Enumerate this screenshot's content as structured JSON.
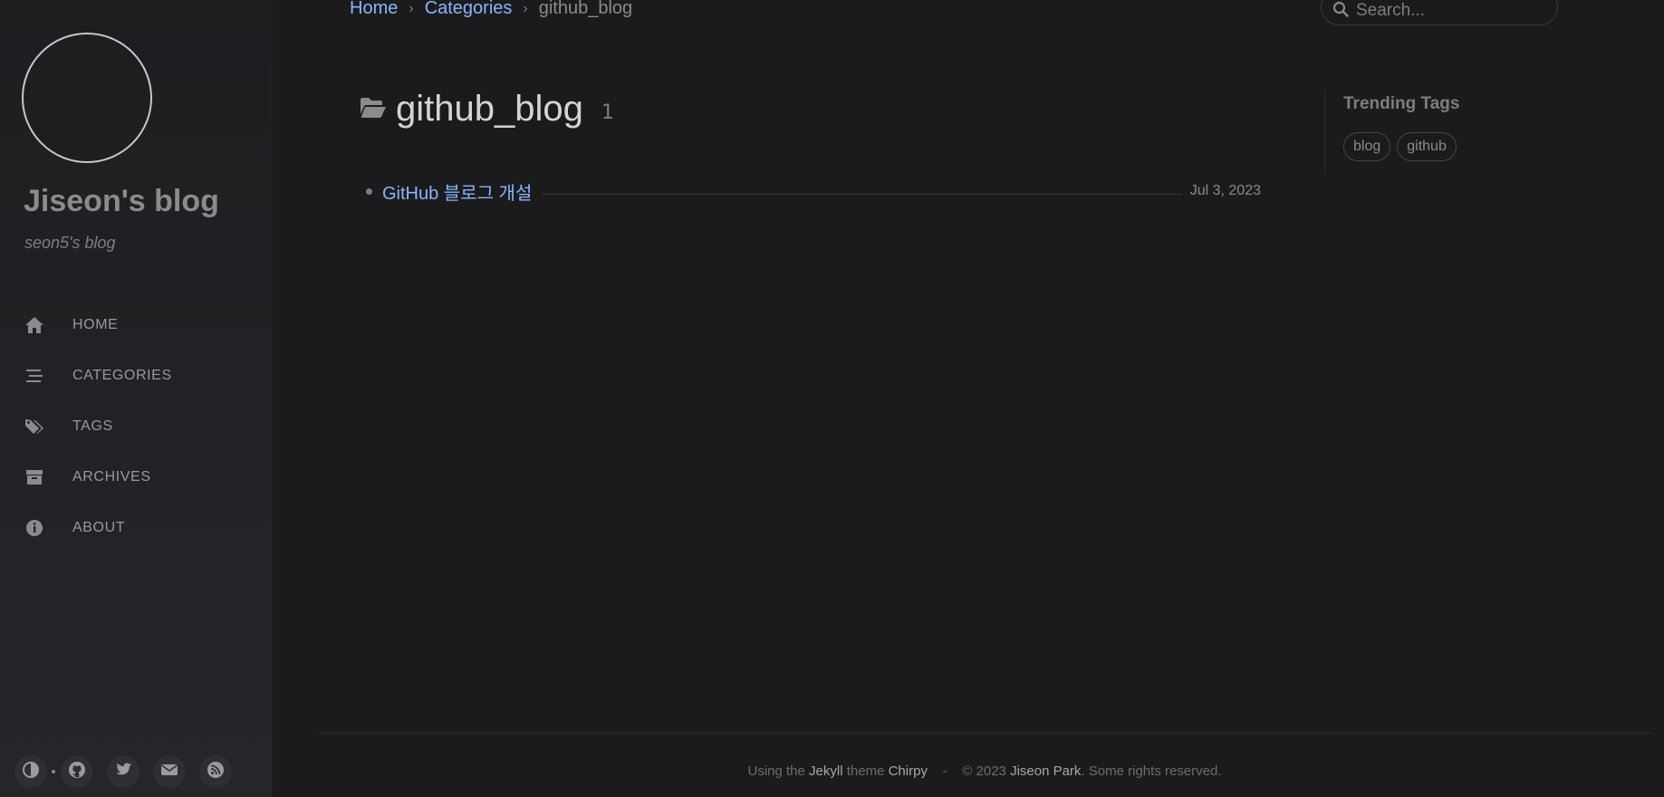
{
  "sidebar": {
    "site_title": "Jiseon's blog",
    "site_subtitle": "seon5's blog",
    "nav": [
      {
        "label": "HOME",
        "icon": "home-icon"
      },
      {
        "label": "CATEGORIES",
        "icon": "stream-icon"
      },
      {
        "label": "TAGS",
        "icon": "tags-icon"
      },
      {
        "label": "ARCHIVES",
        "icon": "archive-icon"
      },
      {
        "label": "ABOUT",
        "icon": "info-circle-icon"
      }
    ],
    "bottom_icons": [
      "theme-toggle-icon",
      "github-icon",
      "twitter-icon",
      "email-icon",
      "rss-icon"
    ]
  },
  "topbar": {
    "breadcrumb": {
      "home": "Home",
      "categories": "Categories",
      "current": "github_blog",
      "separator": "›"
    },
    "search_placeholder": "Search..."
  },
  "main": {
    "heading": {
      "title": "github_blog",
      "count": "1",
      "icon": "folder-open-icon"
    },
    "posts": [
      {
        "title": "GitHub 블로그 개설",
        "date": "Jul 3, 2023"
      }
    ]
  },
  "panel": {
    "title": "Trending Tags",
    "tags": [
      "blog",
      "github"
    ]
  },
  "footer": {
    "using_the": "Using the",
    "jekyll": "Jekyll",
    "theme": "theme",
    "chirpy": "Chirpy",
    "dash": "-",
    "copyright": "© 2023",
    "author": "Jiseon Park",
    "rights": ". Some rights reserved."
  },
  "colors": {
    "background": "#1b1b1e",
    "link": "#8ab4f8",
    "sidebar": "#1e1e21"
  }
}
